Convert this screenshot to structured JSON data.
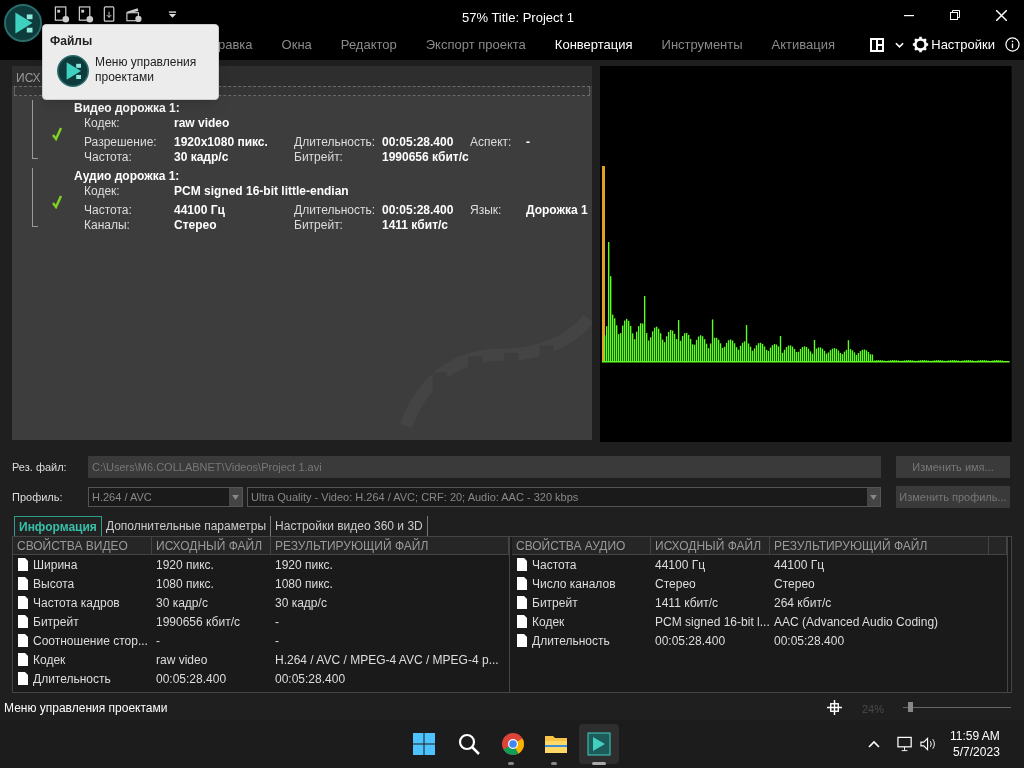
{
  "window": {
    "title": "57% Title: Project 1"
  },
  "popup": {
    "heading": "Файлы",
    "item": "Меню управления проектами"
  },
  "menu": [
    {
      "label": "равка",
      "selected": false
    },
    {
      "label": "Окна",
      "selected": false
    },
    {
      "label": "Редактор",
      "selected": false
    },
    {
      "label": "Экспорт проекта",
      "selected": false
    },
    {
      "label": "Конвертация",
      "selected": true
    },
    {
      "label": "Инструменты",
      "selected": false
    },
    {
      "label": "Активация",
      "selected": false
    }
  ],
  "settings_label": "Настройки",
  "source_panel": {
    "header": "ИСХ",
    "tracks": [
      {
        "title": "Видео дорожка 1:",
        "checked": true,
        "rows": [
          [
            {
              "label": "Кодек:",
              "value": "raw video"
            }
          ],
          [
            {
              "label": "Разрешение:",
              "value": "1920x1080 пикс."
            },
            {
              "label": "Длительность:",
              "value": "00:05:28.400"
            },
            {
              "label": "Аспект:",
              "value": "-"
            }
          ],
          [
            {
              "label": "Частота:",
              "value": "30 кадр/с"
            },
            {
              "label": "Битрейт:",
              "value": "1990656 кбит/с"
            }
          ]
        ]
      },
      {
        "title": "Аудио дорожка 1:",
        "checked": true,
        "rows": [
          [
            {
              "label": "Кодек:",
              "value": "PCM signed 16-bit little-endian"
            }
          ],
          [
            {
              "label": "Частота:",
              "value": "44100 Гц"
            },
            {
              "label": "Длительность:",
              "value": "00:05:28.400"
            },
            {
              "label": "Язык:",
              "value": "Дорожка 1"
            }
          ],
          [
            {
              "label": "Каналы:",
              "value": "Стерео"
            },
            {
              "label": "Битрейт:",
              "value": "1411 кбит/с"
            }
          ]
        ]
      }
    ]
  },
  "output": {
    "file_label": "Рез. файл:",
    "file_value": "C:\\Users\\M6.COLLABNET\\Videos\\Project 1.avi",
    "rename_button": "Изменить имя...",
    "profile_label": "Профиль:",
    "profile_value": "H.264 / AVC",
    "preset_value": "Ultra Quality - Video: H.264 / AVC; CRF: 20; Audio: AAC - 320 kbps",
    "profile_button": "Изменить профиль..."
  },
  "tabs": [
    {
      "label": "Информация",
      "selected": true
    },
    {
      "label": "Дополнительные параметры",
      "selected": false
    },
    {
      "label": "Настройки видео 360 и 3D",
      "selected": false
    }
  ],
  "video_table": {
    "columns": [
      "СВОЙСТВА ВИДЕО",
      "ИСХОДНЫЙ ФАЙЛ",
      "РЕЗУЛЬТИРУЮЩИЙ ФАЙЛ"
    ],
    "rows": [
      [
        "Ширина",
        "1920 пикс.",
        "1920 пикс."
      ],
      [
        "Высота",
        "1080 пикс.",
        "1080 пикс."
      ],
      [
        "Частота кадров",
        "30 кадр/с",
        "30 кадр/с"
      ],
      [
        "Битрейт",
        "1990656 кбит/с",
        "-"
      ],
      [
        "Соотношение стор...",
        "-",
        "-"
      ],
      [
        "Кодек",
        "raw video",
        "H.264 / AVC / MPEG-4 AVC / MPEG-4 p..."
      ],
      [
        "Длительность",
        "00:05:28.400",
        "00:05:28.400"
      ]
    ]
  },
  "audio_table": {
    "columns": [
      "СВОЙСТВА АУДИО",
      "ИСХОДНЫЙ ФАЙЛ",
      "РЕЗУЛЬТИРУЮЩИЙ ФАЙЛ"
    ],
    "rows": [
      [
        "Частота",
        "44100 Гц",
        "44100 Гц"
      ],
      [
        "Число каналов",
        "Стерео",
        "Стерео"
      ],
      [
        "Битрейт",
        "1411 кбит/с",
        "264 кбит/с"
      ],
      [
        "Кодек",
        "PCM signed 16-bit l...",
        "AAC (Advanced Audio Coding)"
      ],
      [
        "Длительность",
        "00:05:28.400",
        "00:05:28.400"
      ]
    ]
  },
  "status_bar": {
    "text": "Меню управления проектами",
    "zoom": "24%",
    "zoom_slider": {
      "level": 0.05
    }
  },
  "taskbar": {
    "time": "11:59 AM",
    "date": "5/7/2023"
  }
}
